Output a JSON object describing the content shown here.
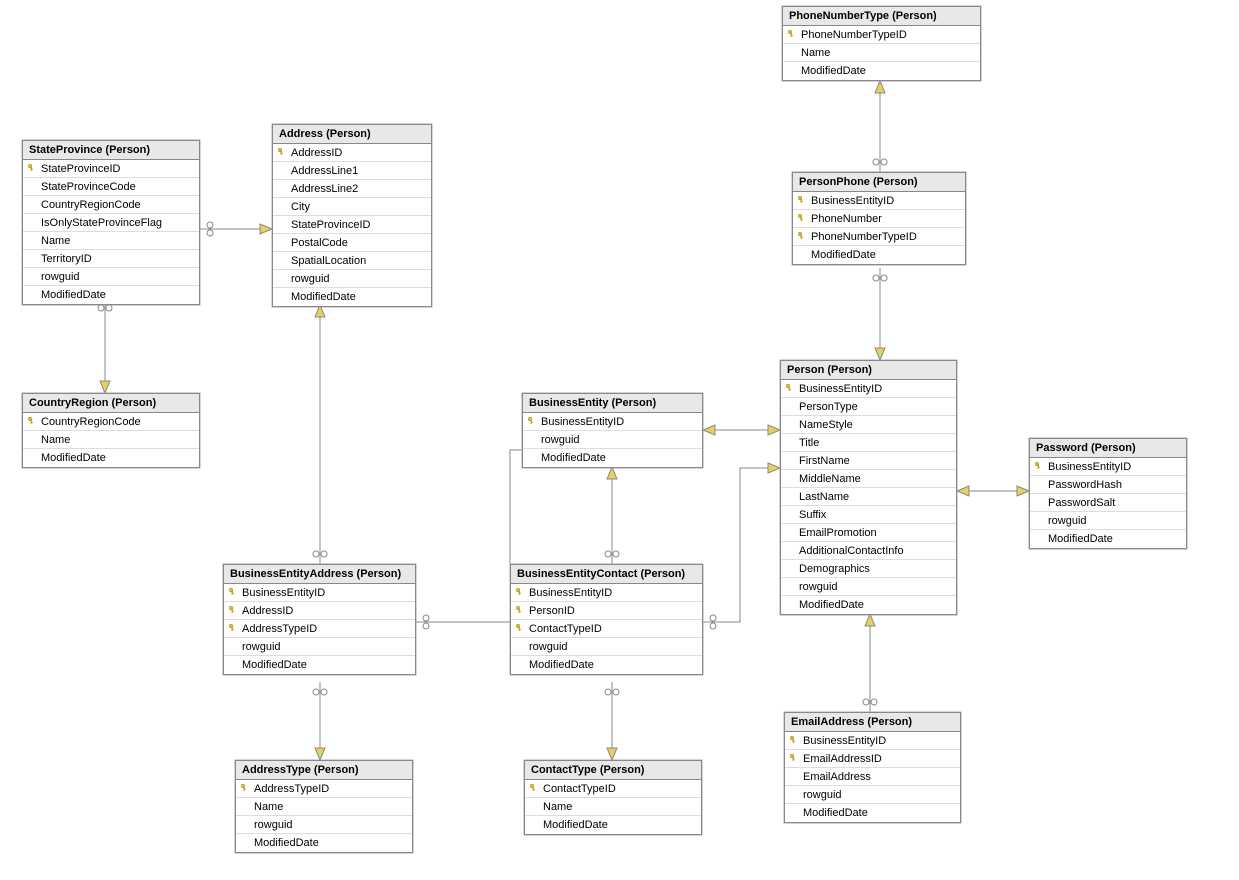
{
  "entities": {
    "StateProvince": {
      "title": "StateProvince (Person)",
      "columns": [
        {
          "name": "StateProvinceID",
          "pk": true
        },
        {
          "name": "StateProvinceCode",
          "pk": false
        },
        {
          "name": "CountryRegionCode",
          "pk": false
        },
        {
          "name": "IsOnlyStateProvinceFlag",
          "pk": false
        },
        {
          "name": "Name",
          "pk": false
        },
        {
          "name": "TerritoryID",
          "pk": false
        },
        {
          "name": "rowguid",
          "pk": false
        },
        {
          "name": "ModifiedDate",
          "pk": false
        }
      ]
    },
    "Address": {
      "title": "Address (Person)",
      "columns": [
        {
          "name": "AddressID",
          "pk": true
        },
        {
          "name": "AddressLine1",
          "pk": false
        },
        {
          "name": "AddressLine2",
          "pk": false
        },
        {
          "name": "City",
          "pk": false
        },
        {
          "name": "StateProvinceID",
          "pk": false
        },
        {
          "name": "PostalCode",
          "pk": false
        },
        {
          "name": "SpatialLocation",
          "pk": false
        },
        {
          "name": "rowguid",
          "pk": false
        },
        {
          "name": "ModifiedDate",
          "pk": false
        }
      ]
    },
    "CountryRegion": {
      "title": "CountryRegion (Person)",
      "columns": [
        {
          "name": "CountryRegionCode",
          "pk": true
        },
        {
          "name": "Name",
          "pk": false
        },
        {
          "name": "ModifiedDate",
          "pk": false
        }
      ]
    },
    "PhoneNumberType": {
      "title": "PhoneNumberType (Person)",
      "columns": [
        {
          "name": "PhoneNumberTypeID",
          "pk": true
        },
        {
          "name": "Name",
          "pk": false
        },
        {
          "name": "ModifiedDate",
          "pk": false
        }
      ]
    },
    "PersonPhone": {
      "title": "PersonPhone (Person)",
      "columns": [
        {
          "name": "BusinessEntityID",
          "pk": true
        },
        {
          "name": "PhoneNumber",
          "pk": true
        },
        {
          "name": "PhoneNumberTypeID",
          "pk": true
        },
        {
          "name": "ModifiedDate",
          "pk": false
        }
      ]
    },
    "BusinessEntity": {
      "title": "BusinessEntity (Person)",
      "columns": [
        {
          "name": "BusinessEntityID",
          "pk": true
        },
        {
          "name": "rowguid",
          "pk": false
        },
        {
          "name": "ModifiedDate",
          "pk": false
        }
      ]
    },
    "Person": {
      "title": "Person (Person)",
      "columns": [
        {
          "name": "BusinessEntityID",
          "pk": true
        },
        {
          "name": "PersonType",
          "pk": false
        },
        {
          "name": "NameStyle",
          "pk": false
        },
        {
          "name": "Title",
          "pk": false
        },
        {
          "name": "FirstName",
          "pk": false
        },
        {
          "name": "MiddleName",
          "pk": false
        },
        {
          "name": "LastName",
          "pk": false
        },
        {
          "name": "Suffix",
          "pk": false
        },
        {
          "name": "EmailPromotion",
          "pk": false
        },
        {
          "name": "AdditionalContactInfo",
          "pk": false
        },
        {
          "name": "Demographics",
          "pk": false
        },
        {
          "name": "rowguid",
          "pk": false
        },
        {
          "name": "ModifiedDate",
          "pk": false
        }
      ]
    },
    "Password": {
      "title": "Password (Person)",
      "columns": [
        {
          "name": "BusinessEntityID",
          "pk": true
        },
        {
          "name": "PasswordHash",
          "pk": false
        },
        {
          "name": "PasswordSalt",
          "pk": false
        },
        {
          "name": "rowguid",
          "pk": false
        },
        {
          "name": "ModifiedDate",
          "pk": false
        }
      ]
    },
    "BusinessEntityAddress": {
      "title": "BusinessEntityAddress (Person)",
      "columns": [
        {
          "name": "BusinessEntityID",
          "pk": true
        },
        {
          "name": "AddressID",
          "pk": true
        },
        {
          "name": "AddressTypeID",
          "pk": true
        },
        {
          "name": "rowguid",
          "pk": false
        },
        {
          "name": "ModifiedDate",
          "pk": false
        }
      ]
    },
    "BusinessEntityContact": {
      "title": "BusinessEntityContact (Person)",
      "columns": [
        {
          "name": "BusinessEntityID",
          "pk": true
        },
        {
          "name": "PersonID",
          "pk": true
        },
        {
          "name": "ContactTypeID",
          "pk": true
        },
        {
          "name": "rowguid",
          "pk": false
        },
        {
          "name": "ModifiedDate",
          "pk": false
        }
      ]
    },
    "AddressType": {
      "title": "AddressType (Person)",
      "columns": [
        {
          "name": "AddressTypeID",
          "pk": true
        },
        {
          "name": "Name",
          "pk": false
        },
        {
          "name": "rowguid",
          "pk": false
        },
        {
          "name": "ModifiedDate",
          "pk": false
        }
      ]
    },
    "ContactType": {
      "title": "ContactType (Person)",
      "columns": [
        {
          "name": "ContactTypeID",
          "pk": true
        },
        {
          "name": "Name",
          "pk": false
        },
        {
          "name": "ModifiedDate",
          "pk": false
        }
      ]
    },
    "EmailAddress": {
      "title": "EmailAddress (Person)",
      "columns": [
        {
          "name": "BusinessEntityID",
          "pk": true
        },
        {
          "name": "EmailAddressID",
          "pk": true
        },
        {
          "name": "EmailAddress",
          "pk": false
        },
        {
          "name": "rowguid",
          "pk": false
        },
        {
          "name": "ModifiedDate",
          "pk": false
        }
      ]
    }
  },
  "relationships": [
    {
      "from": "Address",
      "to": "StateProvince",
      "type": "many-to-one"
    },
    {
      "from": "StateProvince",
      "to": "CountryRegion",
      "type": "many-to-one"
    },
    {
      "from": "BusinessEntityAddress",
      "to": "Address",
      "type": "many-to-one"
    },
    {
      "from": "BusinessEntityAddress",
      "to": "BusinessEntity",
      "type": "many-to-one"
    },
    {
      "from": "BusinessEntityAddress",
      "to": "AddressType",
      "type": "many-to-one"
    },
    {
      "from": "BusinessEntityContact",
      "to": "BusinessEntity",
      "type": "many-to-one"
    },
    {
      "from": "BusinessEntityContact",
      "to": "Person",
      "type": "many-to-one"
    },
    {
      "from": "BusinessEntityContact",
      "to": "ContactType",
      "type": "many-to-one"
    },
    {
      "from": "PersonPhone",
      "to": "PhoneNumberType",
      "type": "many-to-one"
    },
    {
      "from": "PersonPhone",
      "to": "Person",
      "type": "many-to-one"
    },
    {
      "from": "Person",
      "to": "BusinessEntity",
      "type": "one-to-one"
    },
    {
      "from": "Password",
      "to": "Person",
      "type": "one-to-one"
    },
    {
      "from": "EmailAddress",
      "to": "Person",
      "type": "many-to-one"
    }
  ]
}
